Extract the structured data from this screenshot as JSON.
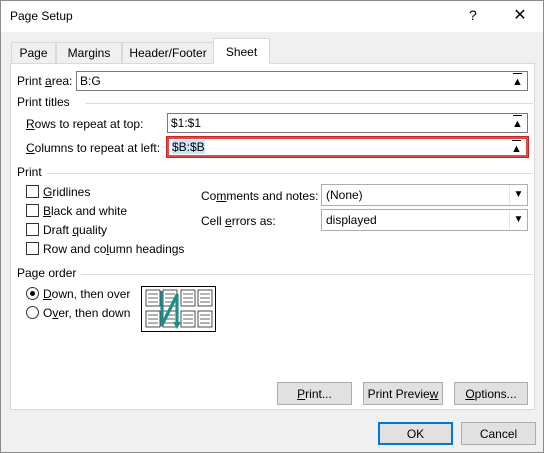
{
  "window": {
    "title": "Page Setup",
    "help": "?",
    "close": "✕"
  },
  "tabs": [
    {
      "label": "Page"
    },
    {
      "label": "Margins"
    },
    {
      "label": "Header/Footer"
    },
    {
      "label": "Sheet"
    }
  ],
  "print_area": {
    "label_pre": "Print ",
    "label_u": "a",
    "label_post": "rea:",
    "value": "B:G"
  },
  "print_titles": {
    "heading": "Print titles",
    "rows": {
      "label_u": "R",
      "label_post": "ows to repeat at top:",
      "value": "$1:$1"
    },
    "cols": {
      "label_u": "C",
      "label_post": "olumns to repeat at left:",
      "value": "$B:$B"
    }
  },
  "print": {
    "heading": "Print",
    "gridlines": {
      "label_u": "G",
      "label_post": "ridlines",
      "checked": false
    },
    "black_white": {
      "label_u": "B",
      "label_post": "lack and white",
      "checked": false
    },
    "draft": {
      "label_pre": "Draft ",
      "label_u": "q",
      "label_post": "uality",
      "checked": false
    },
    "headings": {
      "label_pre": "Row and co",
      "label_u": "l",
      "label_post": "umn headings",
      "checked": false
    },
    "comments": {
      "label_pre": "Co",
      "label_u": "m",
      "label_post": "ments and notes:",
      "value": "(None)"
    },
    "errors": {
      "label_pre": "Cell ",
      "label_u": "e",
      "label_post": "rrors as:",
      "value": "displayed"
    }
  },
  "page_order": {
    "heading": "Page order",
    "down_then_over": {
      "label_u": "D",
      "label_post": "own, then over",
      "selected": true
    },
    "over_then_down": {
      "label_pre": "O",
      "label_u": "v",
      "label_post": "er, then down",
      "selected": false
    }
  },
  "buttons": {
    "print": {
      "label_u": "P",
      "label_post": "rint..."
    },
    "preview": {
      "label_pre": "Print Previe",
      "label_u": "w",
      "label_post": ""
    },
    "options": {
      "label_u": "O",
      "label_post": "ptions..."
    },
    "ok": "OK",
    "cancel": "Cancel"
  },
  "icons": {
    "ref_button": "collapse-dialog-icon",
    "dropdown": "chevron-down-icon",
    "page_order_preview": "page-order-diagram-icon"
  },
  "colors": {
    "focus_border": "#e24a4a",
    "default_button": "#0078d7",
    "diagram_accent": "#1e8c8c"
  }
}
